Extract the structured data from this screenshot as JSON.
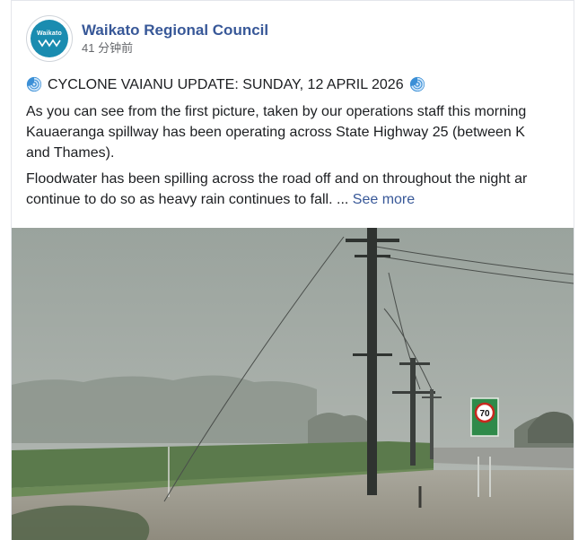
{
  "post": {
    "page_name": "Waikato Regional Council",
    "timestamp": "41 分钟前",
    "avatar_text": "Waikato",
    "headline": "CYCLONE VAIANU UPDATE: SUNDAY, 12 APRIL 2026",
    "para1_line1": "As you can see from the first picture, taken by our operations staff this morning",
    "para1_line2": "Kauaeranga spillway has been operating across State Highway 25 (between K",
    "para1_line3": "and Thames).",
    "para2_line1": "Floodwater has been spilling across the road off and on throughout the night ar",
    "para2_line2": "continue to do so as heavy rain continues to fall. ...",
    "see_more": "See more",
    "speed_sign": "70"
  },
  "colors": {
    "link": "#385898",
    "text": "#1c1e21",
    "muted": "#65676b",
    "brand": "#1a8cb0"
  }
}
